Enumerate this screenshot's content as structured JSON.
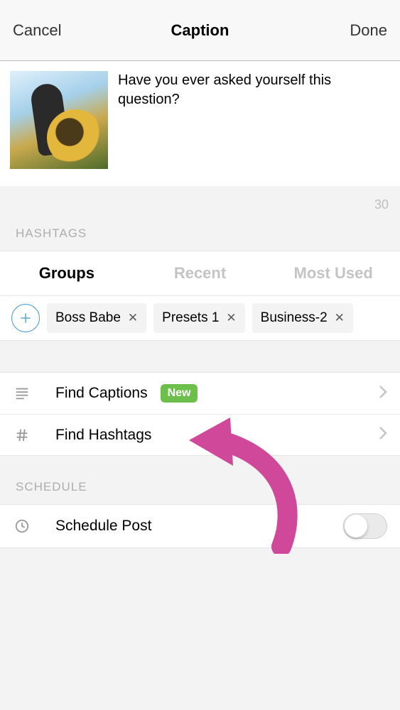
{
  "header": {
    "cancel": "Cancel",
    "title": "Caption",
    "done": "Done"
  },
  "caption": {
    "text": "Have you ever asked yourself this question?",
    "count": "30"
  },
  "hashtags": {
    "section_label": "HASHTAGS",
    "tabs": {
      "groups": "Groups",
      "recent": "Recent",
      "most_used": "Most Used"
    },
    "chips": [
      "Boss Babe",
      "Presets 1",
      "Business-2"
    ]
  },
  "find": {
    "captions": "Find Captions",
    "captions_badge": "New",
    "hashtags": "Find Hashtags"
  },
  "schedule": {
    "section_label": "SCHEDULE",
    "label": "Schedule Post"
  }
}
